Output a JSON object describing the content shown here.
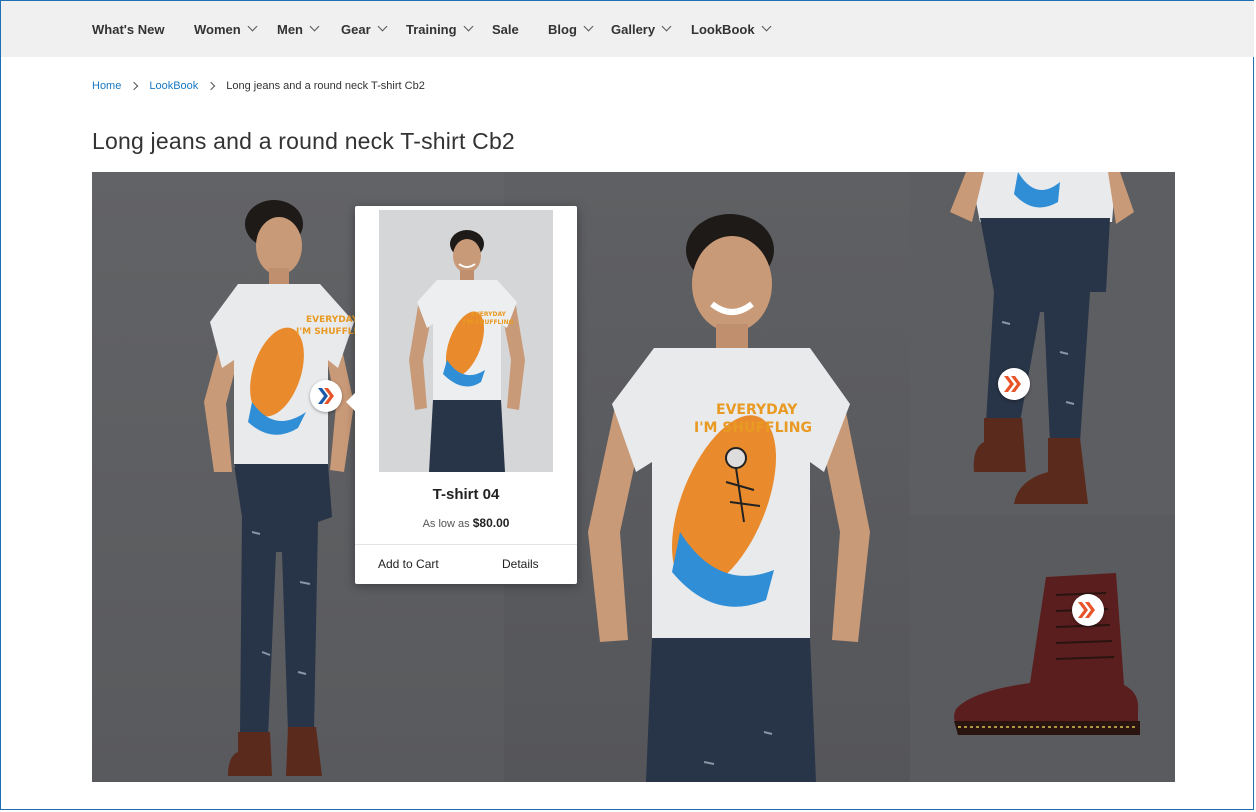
{
  "nav": {
    "items": [
      {
        "label": "What's New",
        "has_dropdown": false
      },
      {
        "label": "Women",
        "has_dropdown": true
      },
      {
        "label": "Men",
        "has_dropdown": true
      },
      {
        "label": "Gear",
        "has_dropdown": true
      },
      {
        "label": "Training",
        "has_dropdown": true
      },
      {
        "label": "Sale",
        "has_dropdown": false
      },
      {
        "label": "Blog",
        "has_dropdown": true
      },
      {
        "label": "Gallery",
        "has_dropdown": true
      },
      {
        "label": "LookBook",
        "has_dropdown": true
      }
    ]
  },
  "breadcrumb": {
    "home": "Home",
    "lookbook": "LookBook",
    "current": "Long jeans and a round neck T-shirt Cb2"
  },
  "page": {
    "title": "Long jeans and a round neck T-shirt Cb2"
  },
  "gallery": {
    "shirt_print_line1": "EVERYDAY",
    "shirt_print_line2": "I'M SHUFFLING",
    "hotspot_icon": "double-chevron-right-icon"
  },
  "popup": {
    "product_name": "T-shirt 04",
    "price_prefix": "As low as",
    "price": "$80.00",
    "add_to_cart_label": "Add to Cart",
    "details_label": "Details"
  },
  "colors": {
    "link": "#1979c3",
    "nav_background": "#f0f0f0",
    "hotspot_orange": "#e8542a",
    "hotspot_blue": "#1a5aa8",
    "border": "#1f6fb5"
  }
}
